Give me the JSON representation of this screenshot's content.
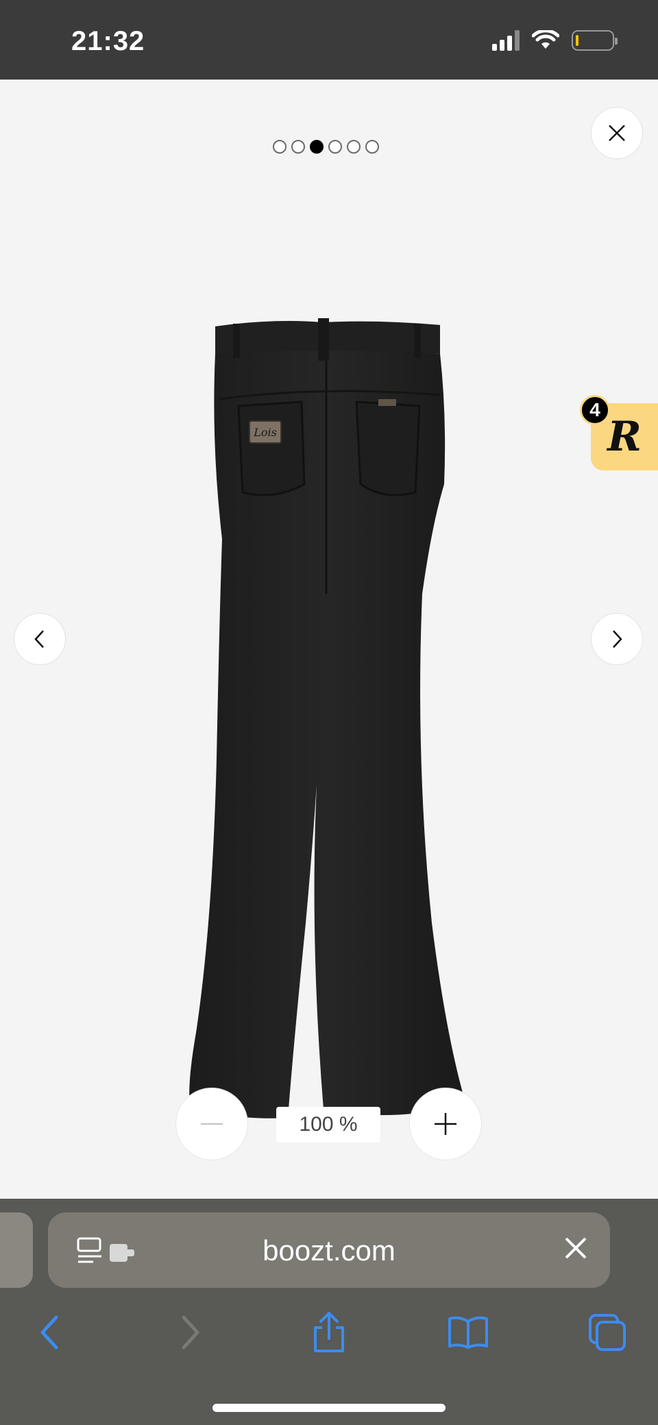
{
  "status_bar": {
    "time": "21:32"
  },
  "gallery": {
    "slide_count": 6,
    "active_slide_index": 2
  },
  "rewards": {
    "count": "4",
    "letter": "R"
  },
  "product_image": {
    "label": "Lois"
  },
  "zoom": {
    "level": "100 %"
  },
  "browser": {
    "url": "boozt.com"
  },
  "colors": {
    "status_bar": "#3b3b3b",
    "viewer_bg": "#f4f4f4",
    "browser_bar": "#595955",
    "url_bar": "#7c7a72",
    "accent_blue": "#3c8cf0",
    "rewards_badge": "#fcd781"
  },
  "icons": {
    "close": "close-icon",
    "prev": "chevron-left-icon",
    "next": "chevron-right-icon",
    "zoom_out": "minus-icon",
    "zoom_in": "plus-icon",
    "reader": "reader-mode-icon",
    "clear": "close-icon",
    "back": "back-arrow-icon",
    "forward": "forward-arrow-icon",
    "share": "share-icon",
    "bookmarks": "bookmarks-icon",
    "tabs": "tabs-icon"
  }
}
